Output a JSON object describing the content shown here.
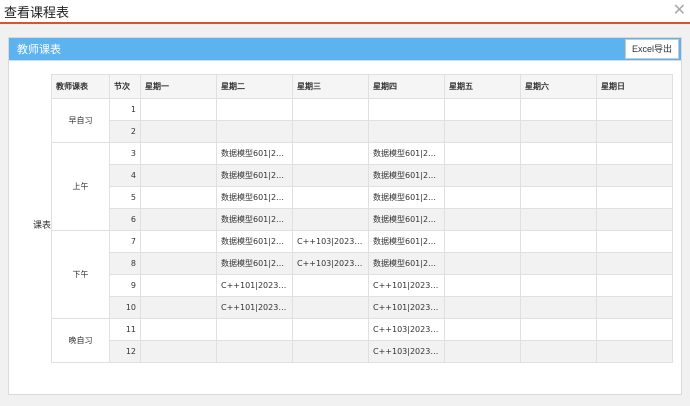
{
  "window": {
    "title": "查看课程表",
    "close_symbol": "✕"
  },
  "panel": {
    "title": "教师课表",
    "export_label": "Excel导出",
    "row_label": "课表"
  },
  "table": {
    "headers": [
      "教师课表",
      "节次",
      "星期一",
      "星期二",
      "星期三",
      "星期四",
      "星期五",
      "星期六",
      "星期日"
    ],
    "periods": [
      {
        "name": "早自习",
        "rows": [
          {
            "section": "1",
            "cells": [
              "",
              "",
              "",
              "",
              "",
              "",
              ""
            ]
          },
          {
            "section": "2",
            "cells": [
              "",
              "",
              "",
              "",
              "",
              "",
              ""
            ]
          }
        ]
      },
      {
        "name": "上午",
        "rows": [
          {
            "section": "3",
            "cells": [
              "",
              "数据模型601|2…",
              "",
              "数据模型601|2…",
              "",
              "",
              ""
            ]
          },
          {
            "section": "4",
            "cells": [
              "",
              "数据模型601|2…",
              "",
              "数据模型601|2…",
              "",
              "",
              ""
            ]
          },
          {
            "section": "5",
            "cells": [
              "",
              "数据模型601|2…",
              "",
              "数据模型601|2…",
              "",
              "",
              ""
            ]
          },
          {
            "section": "6",
            "cells": [
              "",
              "数据模型601|2…",
              "",
              "数据模型601|2…",
              "",
              "",
              ""
            ]
          }
        ]
      },
      {
        "name": "下午",
        "rows": [
          {
            "section": "7",
            "cells": [
              "",
              "数据模型601|2…",
              "C++103|2023年…",
              "数据模型601|2…",
              "",
              "",
              ""
            ]
          },
          {
            "section": "8",
            "cells": [
              "",
              "数据模型601|2…",
              "C++103|2023年…",
              "数据模型601|2…",
              "",
              "",
              ""
            ]
          },
          {
            "section": "9",
            "cells": [
              "",
              "C++101|2023年…",
              "",
              "C++101|2023年…",
              "",
              "",
              ""
            ]
          },
          {
            "section": "10",
            "cells": [
              "",
              "C++101|2023年…",
              "",
              "C++101|2023年…",
              "",
              "",
              ""
            ]
          }
        ]
      },
      {
        "name": "晚自习",
        "rows": [
          {
            "section": "11",
            "cells": [
              "",
              "",
              "",
              "C++103|2023年…",
              "",
              "",
              ""
            ]
          },
          {
            "section": "12",
            "cells": [
              "",
              "",
              "",
              "C++103|2023年…",
              "",
              "",
              ""
            ]
          }
        ]
      }
    ]
  }
}
